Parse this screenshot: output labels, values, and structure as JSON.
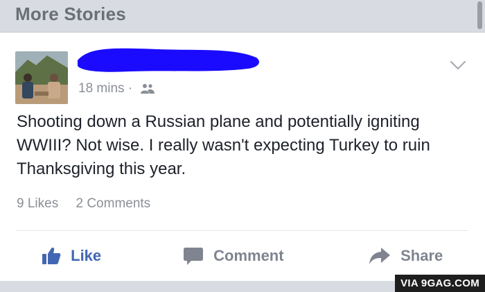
{
  "header": {
    "title": "More Stories"
  },
  "post": {
    "timestamp": "18 mins",
    "separator": "·",
    "audience_icon": "friends-icon",
    "text": "Shooting down a Russian plane and potentially igniting WWIII? Not wise. I really wasn't expecting Turkey to ruin Thanksgiving this year.",
    "likes": "9 Likes",
    "comments": "2 Comments"
  },
  "actions": {
    "like_label": "Like",
    "comment_label": "Comment",
    "share_label": "Share"
  },
  "watermark": "VIA 9GAG.COM",
  "colors": {
    "accent": "#4267b2",
    "redaction": "#1a0bff"
  }
}
